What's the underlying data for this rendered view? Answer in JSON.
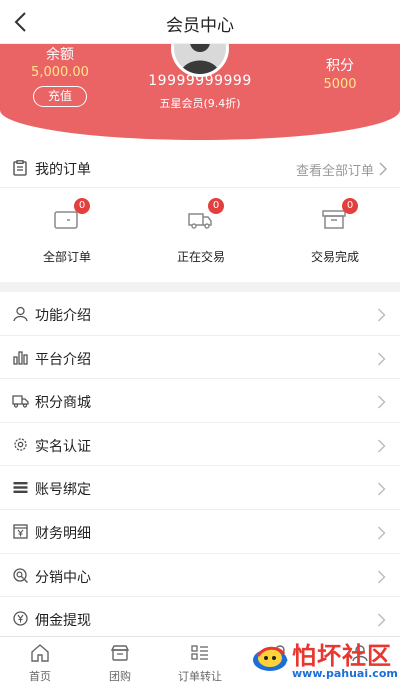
{
  "header": {
    "title": "会员中心"
  },
  "member": {
    "balance_label": "余额",
    "balance_value": "5,000.00",
    "topup_label": "充值",
    "phone": "19999999999",
    "level": "五星会员(9.4折)",
    "points_label": "积分",
    "points_value": "5000"
  },
  "orders": {
    "title": "我的订单",
    "view_all": "查看全部订单",
    "items": [
      {
        "label": "全部订单",
        "badge": "0",
        "icon": "wallet-icon"
      },
      {
        "label": "正在交易",
        "badge": "0",
        "icon": "truck-icon"
      },
      {
        "label": "交易完成",
        "badge": "0",
        "icon": "box-icon"
      }
    ]
  },
  "menu": {
    "items": [
      {
        "label": "功能介绍",
        "icon": "user-icon"
      },
      {
        "label": "平台介绍",
        "icon": "bar-chart-icon"
      },
      {
        "label": "积分商城",
        "icon": "truck-icon"
      },
      {
        "label": "实名认证",
        "icon": "gear-icon"
      },
      {
        "label": "账号绑定",
        "icon": "list-icon"
      },
      {
        "label": "财务明细",
        "icon": "yen-box-icon"
      },
      {
        "label": "分销中心",
        "icon": "search-circle-icon"
      },
      {
        "label": "佣金提现",
        "icon": "yen-circle-icon"
      }
    ]
  },
  "tabbar": {
    "items": [
      {
        "label": "首页",
        "icon": "home-icon"
      },
      {
        "label": "团购",
        "icon": "shop-icon"
      },
      {
        "label": "订单转让",
        "icon": "order-list-icon"
      },
      {
        "label": "",
        "icon": "person-icon"
      },
      {
        "label": "",
        "icon": "person-icon"
      }
    ]
  },
  "watermark": {
    "title": "怕坏社区",
    "url": "www.pahuai.com"
  },
  "colors": {
    "banner": "#ea6465",
    "accent_gold": "#ffe48a",
    "badge": "#e2403f"
  }
}
